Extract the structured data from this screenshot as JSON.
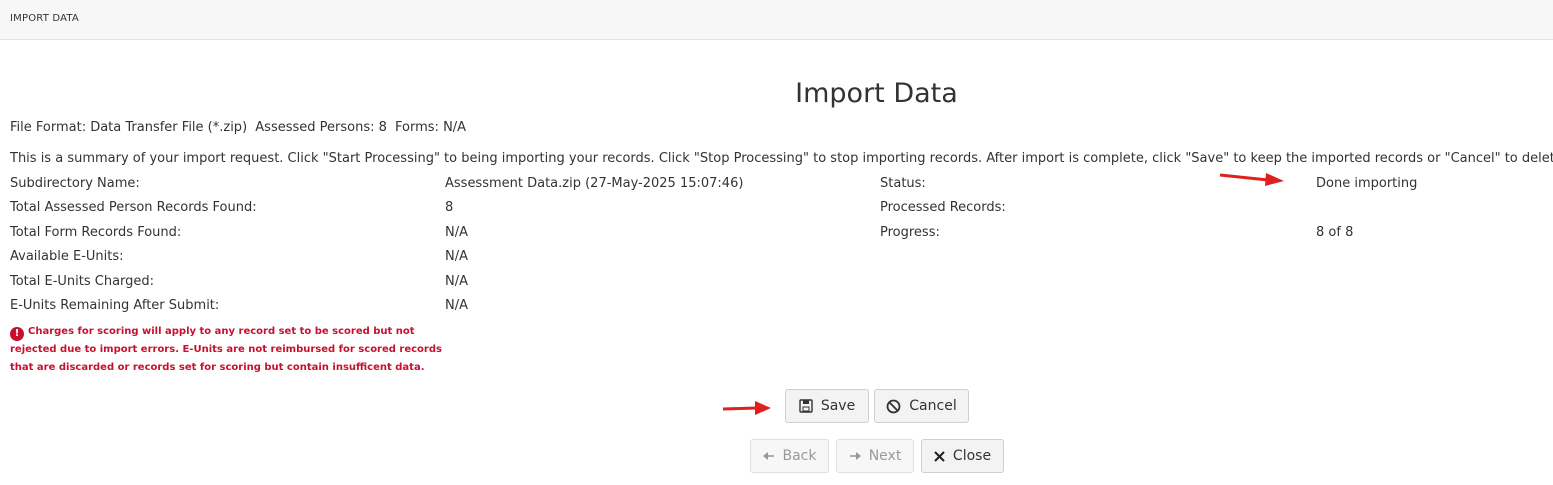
{
  "header": {
    "title": "IMPORT DATA"
  },
  "page": {
    "title": "Import Data"
  },
  "meta": {
    "file_format": "File Format: Data Transfer File (*.zip)",
    "assessed_persons": "Assessed Persons: 8",
    "forms": "Forms: N/A"
  },
  "summary_text": "This is a summary of your import request. Click \"Start Processing\" to being importing your records. Click \"Stop Processing\" to stop importing records. After import is complete, click \"Save\" to keep the imported records or \"Cancel\" to delete them.",
  "details": {
    "subdirectory_label": "Subdirectory Name:",
    "subdirectory_value": "Assessment Data.zip (27-May-2025 15:07:46)",
    "assessed_label": "Total Assessed Person Records Found:",
    "assessed_value": "8",
    "forms_label": "Total Form Records Found:",
    "forms_value": "N/A",
    "available_label": "Available E-Units:",
    "available_value": "N/A",
    "charged_label": "Total E-Units Charged:",
    "charged_value": "N/A",
    "remaining_label": "E-Units Remaining After Submit:",
    "remaining_value": "N/A"
  },
  "status": {
    "status_label": "Status:",
    "status_value": "Done importing",
    "processed_label": "Processed Records:",
    "progress_label": "Progress:",
    "progress_value": "8 of 8"
  },
  "warning": {
    "icon": "exclamation-circle-icon",
    "text": "Charges for scoring will apply to any record set to be scored but not rejected due to import errors. E-Units are not reimbursed for scored records that are discarded or records set for scoring but contain insufficent data."
  },
  "buttons": {
    "save": "Save",
    "cancel": "Cancel",
    "back": "Back",
    "next": "Next",
    "close": "Close"
  },
  "colors": {
    "warning": "#c8102e",
    "annotation_arrow": "#e02020"
  }
}
